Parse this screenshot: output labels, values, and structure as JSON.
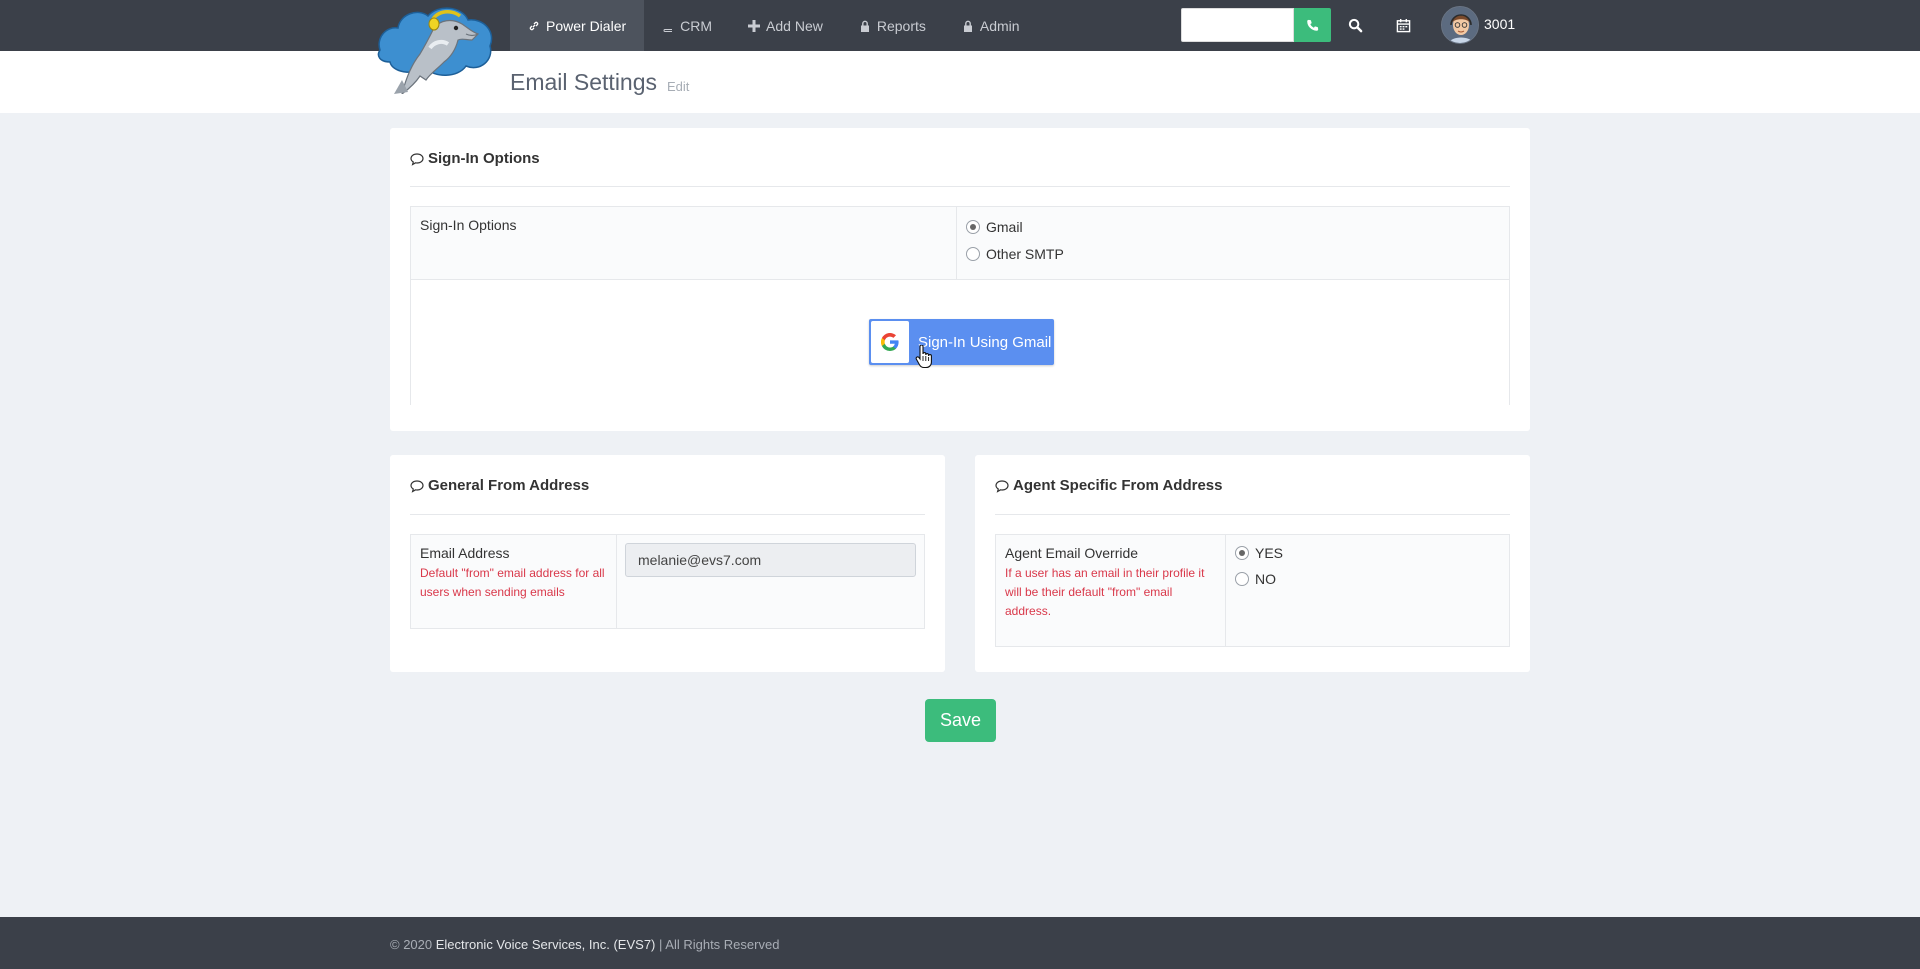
{
  "navbar": {
    "items": [
      {
        "label": "Power Dialer",
        "icon": "link-icon",
        "active": true
      },
      {
        "label": "CRM",
        "icon": "book-icon",
        "active": false
      },
      {
        "label": "Add New",
        "icon": "plus-icon",
        "active": false
      },
      {
        "label": "Reports",
        "icon": "lock-icon",
        "active": false
      },
      {
        "label": "Admin",
        "icon": "lock-icon",
        "active": false
      }
    ],
    "search_value": "",
    "user_extension": "3001"
  },
  "header": {
    "title": "Email Settings",
    "edit_label": "Edit"
  },
  "signin_panel": {
    "title": "Sign-In Options",
    "row_label": "Sign-In Options",
    "options": [
      "Gmail",
      "Other SMTP"
    ],
    "selected": "Gmail",
    "button_label": "Sign-In Using Gmail"
  },
  "general_panel": {
    "title": "General From Address",
    "field_label": "Email Address",
    "field_help": "Default \"from\" email address for all users when sending emails",
    "field_value": "melanie@evs7.com"
  },
  "agent_panel": {
    "title": "Agent Specific From Address",
    "field_label": "Agent Email Override",
    "field_help": "If a user has an email in their profile it will be their default \"from\" email address.",
    "options": [
      "YES",
      "NO"
    ],
    "selected": "YES"
  },
  "save_label": "Save",
  "footer": {
    "prefix": "© 2020 ",
    "company": "Electronic Voice Services, Inc. (EVS7)",
    "suffix": " | All Rights Reserved"
  },
  "colors": {
    "navbar": "#3b4049",
    "accent_green": "#3cbc7c",
    "gmail_blue": "#5b8ff0",
    "help_red": "#d9384a",
    "background": "#eef1f5"
  }
}
